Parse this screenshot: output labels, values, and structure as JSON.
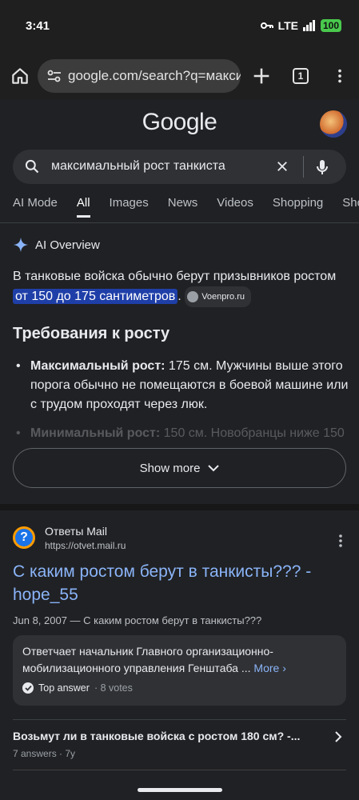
{
  "status": {
    "time": "3:41",
    "network": "LTE",
    "battery": "100"
  },
  "browser": {
    "url": "google.com/search?q=макси",
    "tab_count": "1"
  },
  "google": {
    "logo": "Google",
    "search_query": "максимальный рост танкиста",
    "tabs": [
      "AI Mode",
      "All",
      "Images",
      "News",
      "Videos",
      "Shopping",
      "Shor"
    ],
    "active_tab_index": 1
  },
  "ai_overview": {
    "label": "AI Overview",
    "intro_pre": "В танковые войска обычно берут призывников ростом ",
    "intro_highlight": "от 150 до 175 сантиметров",
    "intro_post": ".",
    "source_chip": "Voenpro.ru",
    "heading": "Требования к росту",
    "bullets": [
      {
        "bold": "Максимальный рост:",
        "text": " 175 см. Мужчины выше этого порога обычно не помещаются в боевой машине или с трудом проходят через люк."
      },
      {
        "bold": "Минимальный рост:",
        "text": " 150 см. Новобранцы ниже 150"
      }
    ],
    "show_more": "Show more"
  },
  "result": {
    "site_name": "Ответы Mail",
    "site_url": "https://otvet.mail.ru",
    "title": "С каким ростом берут в танкисты??? - hope_55",
    "meta": "Jun 8, 2007 — С каким ростом берут в танкисты???",
    "answer_text": "Ответчает начальник Главного организационно-мобилизационного управления Генштаба ...",
    "answer_more": "More",
    "top_answer": "Top answer",
    "votes": "· 8 votes",
    "related_question": "Возьмут ли в танковые войска с ростом 180 см? -...",
    "related_meta": "7 answers · 7y"
  },
  "colors": {
    "link": "#8ab4f8",
    "highlight": "#1f3fa8",
    "battery": "#49c94d"
  }
}
